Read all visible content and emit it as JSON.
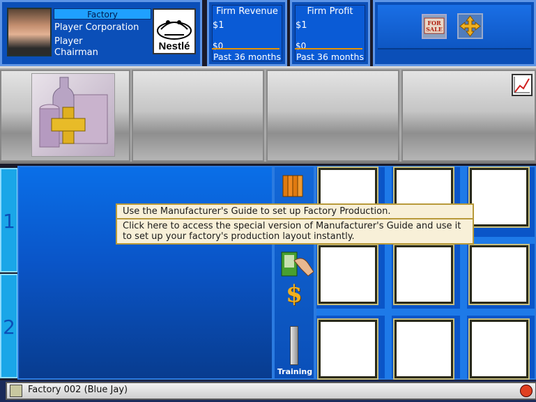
{
  "header": {
    "section_label": "Factory",
    "company_name": "Player Corporation",
    "player_name": "Player",
    "player_title": "Chairman",
    "brand_logo": "Nestlé"
  },
  "metrics": [
    {
      "title": "Firm Revenue",
      "value": "$1",
      "baseline": "$0",
      "period": "Past 36 months"
    },
    {
      "title": "Firm Profit",
      "value": "$1",
      "baseline": "$0",
      "period": "Past 36 months"
    }
  ],
  "controls": {
    "for_sale_icon": "for-sale-sign-icon",
    "move_icon": "move-arrows-icon",
    "chart_icon": "line-chart-icon"
  },
  "left_tabs": [
    "1",
    "2"
  ],
  "side_tools": {
    "training_label": "Training",
    "dollar_glyph": "$"
  },
  "tooltip": {
    "title": "Use the Manufacturer's Guide to set up Factory Production.",
    "body": "Click here to access the special version of Manufacturer's Guide and use it to set up your factory's production layout instantly."
  },
  "status": {
    "factory_name": "Factory 002 (Blue Jay)"
  },
  "colors": {
    "panel_blue": "#0a55c8",
    "accent_orange": "#e89400",
    "tooltip_bg": "#f8f0d8"
  }
}
